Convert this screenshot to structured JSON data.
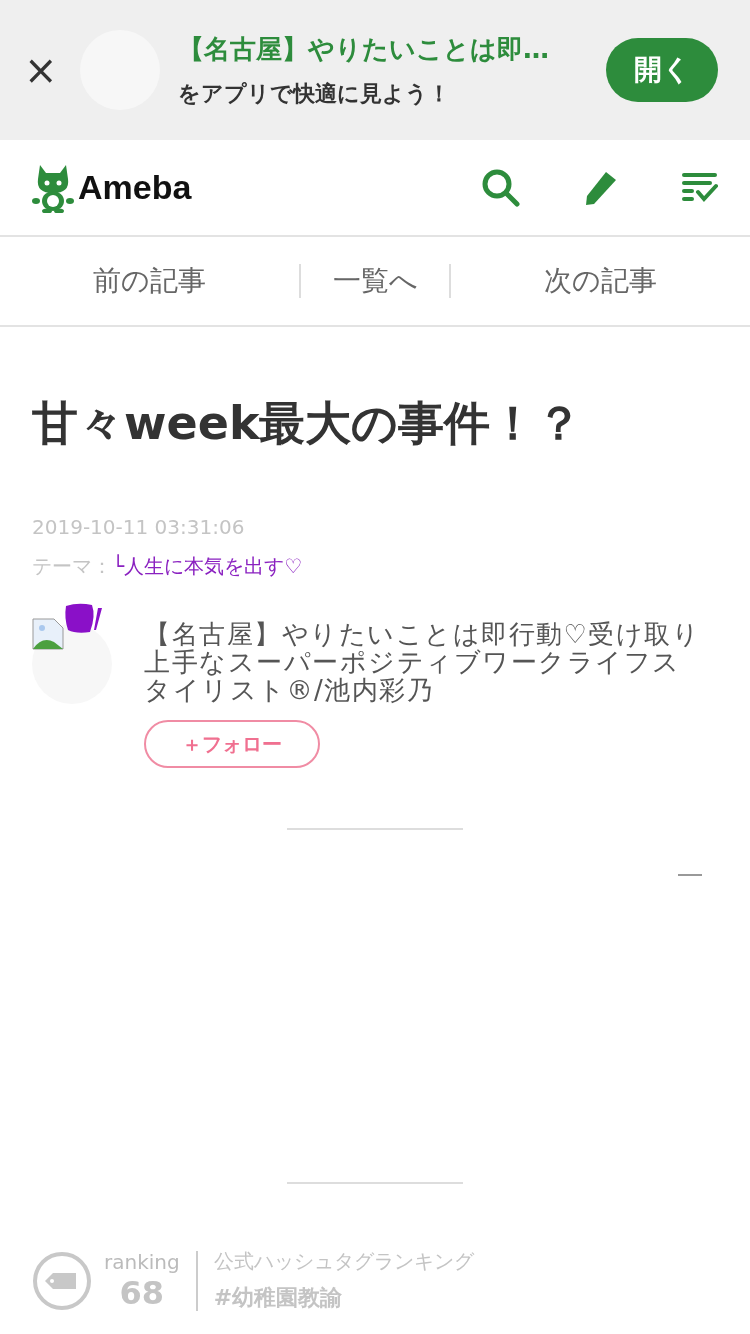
{
  "app_banner": {
    "close": "×",
    "title": "【名古屋】やりたいことは即…",
    "subtitle": "をアプリで快適に見よう！",
    "open_button": "開く"
  },
  "header": {
    "logo": "Ameba"
  },
  "article_nav": [
    {
      "label": "前の記事"
    },
    {
      "label": "一覧へ"
    },
    {
      "label": "次の記事"
    }
  ],
  "article": {
    "title": "甘々week最大の事件！？",
    "date": "2019-10-11 03:31:06",
    "theme_label": "テーマ：",
    "theme": "└人生に本気を出す♡"
  },
  "author": {
    "name": "【名古屋】やりたいことは即行動♡受け取り上手なスーパーポジティブワークライフスタイリスト®/池内彩乃",
    "follow_button": "＋フォロー"
  },
  "ranking": {
    "label": "ranking",
    "rank": "68",
    "title": "公式ハッシュタグランキング",
    "hashtag": "#幼稚園教諭"
  }
}
